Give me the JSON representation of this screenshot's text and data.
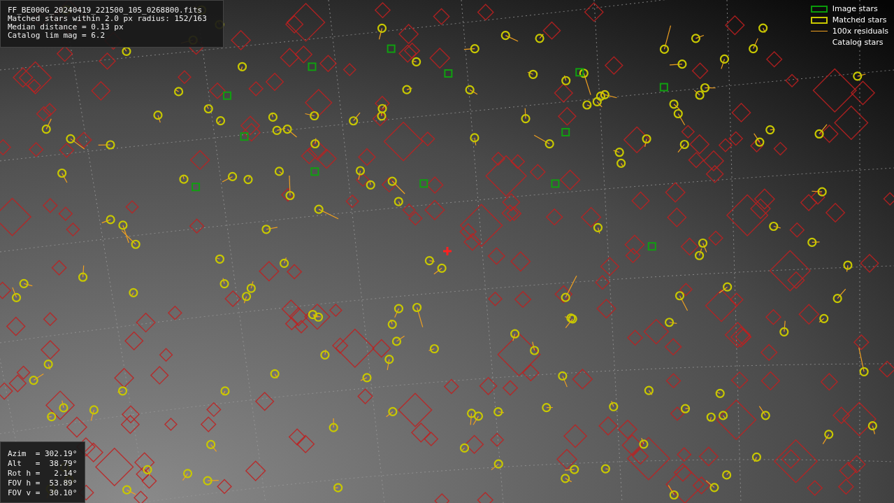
{
  "info_box": {
    "lines": [
      "FF_BE000G_20240419_221500_105_0268800.fits",
      "Matched stars within 2.0 px radius: 152/163",
      "Median distance = 0.13 px",
      "Catalog lim mag = 6.2"
    ]
  },
  "legend": {
    "items": [
      {
        "kind": "box",
        "label": "Image stars",
        "color": "#0a9a0a"
      },
      {
        "kind": "box",
        "label": "Matched stars",
        "color": "#c8c800"
      },
      {
        "kind": "line",
        "label": "100x residuals",
        "color": "#f0a020"
      },
      {
        "kind": "none",
        "label": "Catalog stars"
      }
    ]
  },
  "pointing_box": {
    "lines": [
      "Azim  = 302.19°",
      "Alt   =  38.79°",
      "Rot h =   2.14°",
      "FOV h =  53.89°",
      "FOV v =  30.10°"
    ]
  }
}
